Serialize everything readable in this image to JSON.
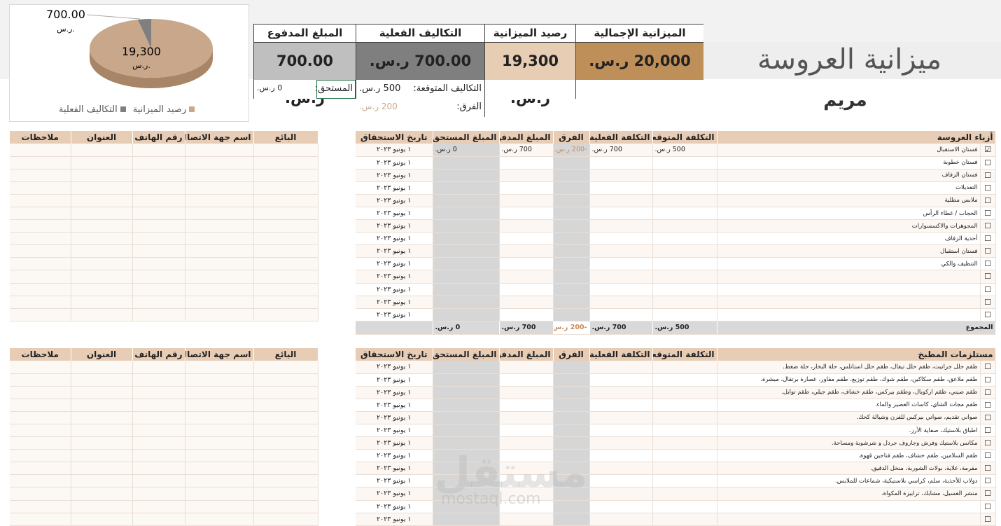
{
  "title": "ميزانية العروسة",
  "bride_name": "مريم",
  "colors": {
    "brown": "#bf8f5a",
    "tan": "#e6cdb3",
    "gray": "#7f7f7f",
    "silver": "#bfbfbf",
    "header": "#e8cdb6"
  },
  "summary": {
    "total_budget": {
      "label": "الميزانية الإجمالية",
      "value": "20,000 ر.س."
    },
    "budget_balance": {
      "label": "رصيد الميزانية",
      "value": "19,300 ر.س."
    },
    "actual_costs": {
      "label": "التكاليف الفعلية",
      "value": "700.00 ر.س."
    },
    "paid_amount": {
      "label": "المبلغ المدفوع",
      "value": "700.00 ر.س."
    },
    "expected_label": "التكاليف المتوقعة:",
    "expected_value": "500 ر.س.",
    "diff_label": "الفرق:",
    "diff_value": "200 ر.س.",
    "due_label": "المستحق:",
    "due_value": "0 ر.س."
  },
  "chart_data": {
    "type": "pie",
    "categories": [
      "رصيد الميزانية",
      "التكاليف الفعلية"
    ],
    "values": [
      19300,
      700
    ],
    "data_labels": [
      "19,300",
      "700.00"
    ],
    "unit_label": "ر.س.",
    "colors": [
      "#c8a78a",
      "#7f7f7f"
    ],
    "legend": "bottom"
  },
  "table1": {
    "headers": [
      "أزياء العروسة",
      "التكلفة المتوقعة",
      "التكلفة الفعلية",
      "الفرق",
      "المبلغ المدفوع",
      "المبلغ المستحق",
      "تاريخ الاستحقاق"
    ],
    "rows": [
      {
        "checked": "☑",
        "item": "فستان الاستقبال",
        "expected": "500 ر.س.",
        "actual": "700 ر.س.",
        "diff": "-200 ر.س.",
        "paid": "700 ر.س.",
        "due": "0 ر.س.",
        "date": "١ يونيو ٢٠٢٣"
      },
      {
        "checked": "☐",
        "item": "فستان خطوبة",
        "expected": "",
        "actual": "",
        "diff": "",
        "paid": "",
        "due": "",
        "date": "١ يونيو ٢٠٢٣"
      },
      {
        "checked": "☐",
        "item": "فستان الزفاف",
        "expected": "",
        "actual": "",
        "diff": "",
        "paid": "",
        "due": "",
        "date": "١ يونيو ٢٠٢٣"
      },
      {
        "checked": "☐",
        "item": "التعديلات",
        "expected": "",
        "actual": "",
        "diff": "",
        "paid": "",
        "due": "",
        "date": "١ يونيو ٢٠٢٣"
      },
      {
        "checked": "☐",
        "item": "ملابس مطلية",
        "expected": "",
        "actual": "",
        "diff": "",
        "paid": "",
        "due": "",
        "date": "١ يونيو ٢٠٢٣"
      },
      {
        "checked": "☐",
        "item": "الحجاب / غطاء الرأس",
        "expected": "",
        "actual": "",
        "diff": "",
        "paid": "",
        "due": "",
        "date": "١ يونيو ٢٠٢٣"
      },
      {
        "checked": "☐",
        "item": "المجوهرات والاكسسوارات",
        "expected": "",
        "actual": "",
        "diff": "",
        "paid": "",
        "due": "",
        "date": "١ يونيو ٢٠٢٣"
      },
      {
        "checked": "☐",
        "item": "أحذية الزفاف",
        "expected": "",
        "actual": "",
        "diff": "",
        "paid": "",
        "due": "",
        "date": "١ يونيو ٢٠٢٣"
      },
      {
        "checked": "☐",
        "item": "فستان استقبال",
        "expected": "",
        "actual": "",
        "diff": "",
        "paid": "",
        "due": "",
        "date": "١ يونيو ٢٠٢٣"
      },
      {
        "checked": "☐",
        "item": "التنظيف والكي",
        "expected": "",
        "actual": "",
        "diff": "",
        "paid": "",
        "due": "",
        "date": "١ يونيو ٢٠٢٣"
      },
      {
        "checked": "☐",
        "item": "",
        "expected": "",
        "actual": "",
        "diff": "",
        "paid": "",
        "due": "",
        "date": "١ يونيو ٢٠٢٣"
      },
      {
        "checked": "☐",
        "item": "",
        "expected": "",
        "actual": "",
        "diff": "",
        "paid": "",
        "due": "",
        "date": "١ يونيو ٢٠٢٣"
      },
      {
        "checked": "☐",
        "item": "",
        "expected": "",
        "actual": "",
        "diff": "",
        "paid": "",
        "due": "",
        "date": "١ يونيو ٢٠٢٣"
      },
      {
        "checked": "☐",
        "item": "",
        "expected": "",
        "actual": "",
        "diff": "",
        "paid": "",
        "due": "",
        "date": "١ يونيو ٢٠٢٣"
      }
    ],
    "total": {
      "label": "المجموع",
      "expected": "500 ر.س.",
      "actual": "700 ر.س.",
      "diff": "-200 ر.س.",
      "paid": "700 ر.س.",
      "due": "0 ر.س."
    }
  },
  "vendor_headers": [
    "البائع",
    "اسم جهة الاتصال",
    "رقم الهاتف",
    "العنوان",
    "ملاحظات"
  ],
  "table2": {
    "headers": [
      "مستلزمات المطبخ",
      "التكلفة المتوقعة",
      "التكلفة الفعلية",
      "الفرق",
      "المبلغ المدفوع",
      "المبلغ المستحق",
      "تاريخ الاستحقاق"
    ],
    "rows": [
      {
        "checked": "☐",
        "item": "طقم حلل جرانيت، طقم حلل تيفال، طقم حلل استانلس، حلة البخار، حلة ضغط.",
        "date": "١ يونيو ٢٠٢٣"
      },
      {
        "checked": "☐",
        "item": "طقم ملاعق، طقم سكاكين، طقم شوك، طقم توزيع، طقم مقاور، عصارة برتقال، مبشرة.",
        "date": "١ يونيو ٢٠٢٣"
      },
      {
        "checked": "☐",
        "item": "طقم صيني، طقم اركوبال، وطقم بيركس، طقم خشاف، طقم جيلي، طقم توابل.",
        "date": "١ يونيو ٢٠٢٣"
      },
      {
        "checked": "☐",
        "item": "طقم مجات الشاي، كاسات العصير والماء.",
        "date": "١ يونيو ٢٠٢٣"
      },
      {
        "checked": "☐",
        "item": "صواني تقديم، صواني بيركس للفرن وشيالة كحك.",
        "date": "١ يونيو ٢٠٢٣"
      },
      {
        "checked": "☐",
        "item": "اطباق بلاستيك، صفاية الأرز.",
        "date": "١ يونيو ٢٠٢٣"
      },
      {
        "checked": "☐",
        "item": "مكانس بلاستيك وفرش وجاروف جردل و شرشوبة ومساحة.",
        "date": "١ يونيو ٢٠٢٣"
      },
      {
        "checked": "☐",
        "item": "طقم السلامين، طقم خشاف، طقم فناجين قهوة.",
        "date": "١ يونيو ٢٠٢٣"
      },
      {
        "checked": "☐",
        "item": "مفرمة، غلاية، بولات الشوربة، منخل الدقيق.",
        "date": "١ يونيو ٢٠٢٣"
      },
      {
        "checked": "☐",
        "item": "دولاب للأحذية، سلم، كراسي بلاستيكية، شماعات للملابس.",
        "date": "١ يونيو ٢٠٢٣"
      },
      {
        "checked": "☐",
        "item": "منشر الغسيل، مشابك، ترابيزة المكواة.",
        "date": "١ يونيو ٢٠٢٣"
      },
      {
        "checked": "☐",
        "item": "",
        "date": "١ يونيو ٢٠٢٣"
      },
      {
        "checked": "☐",
        "item": "",
        "date": "١ يونيو ٢٠٢٣"
      }
    ]
  },
  "watermark": {
    "ar": "مستقل",
    "en": "mostaql.com"
  }
}
